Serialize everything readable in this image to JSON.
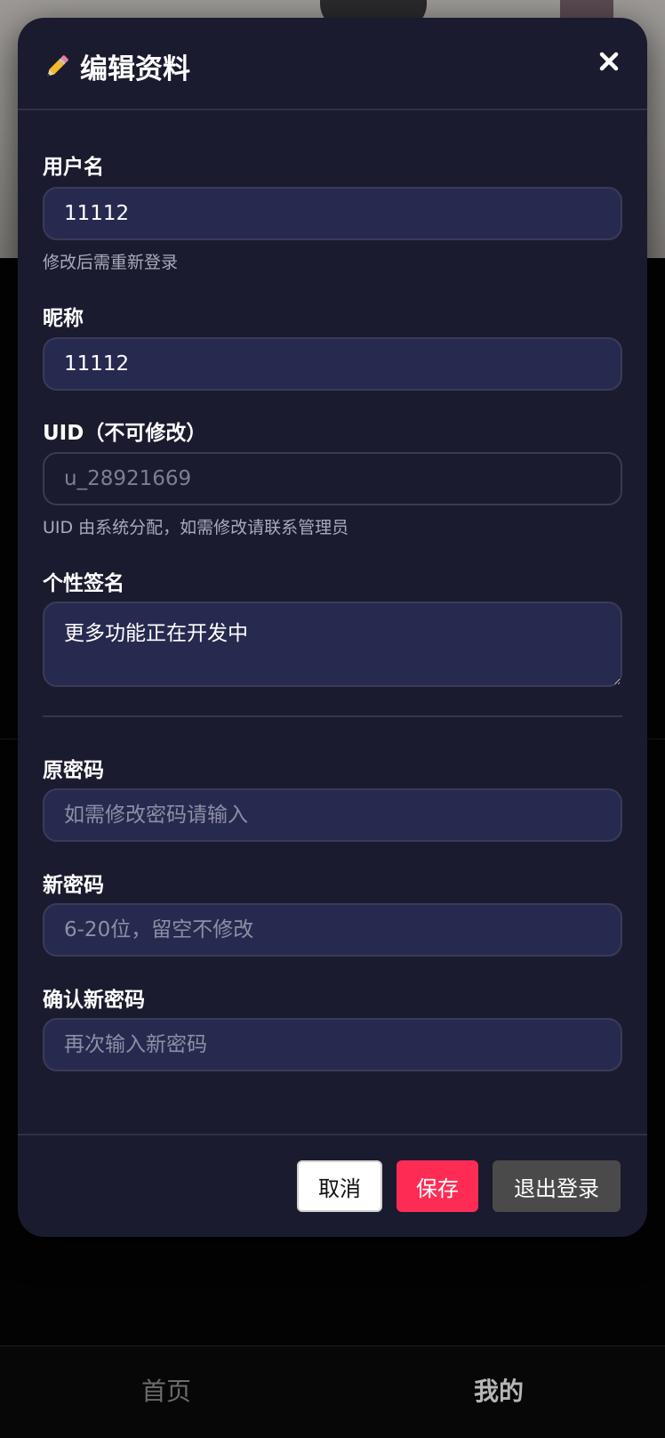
{
  "modal": {
    "title": "编辑资料",
    "title_icon": "pencil-icon",
    "close_icon": "close-icon"
  },
  "form": {
    "username": {
      "label": "用户名",
      "value": "11112",
      "hint": "修改后需重新登录"
    },
    "nickname": {
      "label": "昵称",
      "value": "11112"
    },
    "uid": {
      "label": "UID（不可修改）",
      "value": "u_28921669",
      "hint": "UID 由系统分配，如需修改请联系管理员"
    },
    "signature": {
      "label": "个性签名",
      "value": "更多功能正在开发中"
    },
    "old_password": {
      "label": "原密码",
      "placeholder": "如需修改密码请输入"
    },
    "new_password": {
      "label": "新密码",
      "placeholder": "6-20位，留空不修改"
    },
    "confirm_password": {
      "label": "确认新密码",
      "placeholder": "再次输入新密码"
    }
  },
  "footer": {
    "cancel_label": "取消",
    "save_label": "保存",
    "logout_label": "退出登录"
  },
  "bottom_nav": {
    "items": [
      {
        "label": "首页",
        "active": false
      },
      {
        "label": "我的",
        "active": true
      }
    ]
  },
  "colors": {
    "modal_bg": "#1b1b2f",
    "input_bg": "#272a4f",
    "save_button": "#fe2c55",
    "logout_button": "#4a4a4a"
  }
}
